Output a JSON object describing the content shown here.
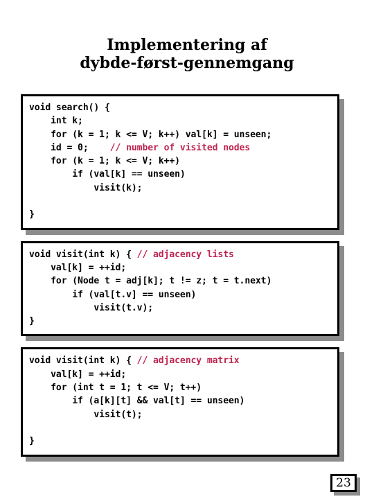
{
  "slide": {
    "title_lines": [
      "Implementering af",
      "dybde-først-gennemgang"
    ],
    "page_number": "23",
    "colors": {
      "text": "#000000",
      "comment": "#bf2350",
      "shadow": "#8c8c8c",
      "background": "#ffffff",
      "border": "#000000"
    }
  },
  "code_blocks": [
    {
      "name": "search-function",
      "lines": [
        [
          {
            "t": "void search() {",
            "k": "code"
          }
        ],
        [
          {
            "t": "    int k;",
            "k": "code"
          }
        ],
        [
          {
            "t": "    for (k = 1; k <= V; k++) val[k] = unseen;",
            "k": "code"
          }
        ],
        [
          {
            "t": "    id = 0;    ",
            "k": "code"
          },
          {
            "t": "// number of visited nodes",
            "k": "comment"
          }
        ],
        [
          {
            "t": "    for (k = 1; k <= V; k++)",
            "k": "code"
          }
        ],
        [
          {
            "t": "        if (val[k] == unseen)",
            "k": "code"
          }
        ],
        [
          {
            "t": "            visit(k);",
            "k": "code"
          }
        ],
        [
          {
            "t": "",
            "k": "code"
          }
        ],
        [
          {
            "t": "}",
            "k": "code"
          }
        ]
      ]
    },
    {
      "name": "visit-adjacency-lists",
      "lines": [
        [
          {
            "t": "void visit(int k) { ",
            "k": "code"
          },
          {
            "t": "// adjacency lists",
            "k": "comment"
          }
        ],
        [
          {
            "t": "    val[k] = ++id;",
            "k": "code"
          }
        ],
        [
          {
            "t": "    for (Node t = adj[k]; t != z; t = t.next)",
            "k": "code"
          }
        ],
        [
          {
            "t": "        if (val[t.v] == unseen)",
            "k": "code"
          }
        ],
        [
          {
            "t": "            visit(t.v);",
            "k": "code"
          }
        ],
        [
          {
            "t": "}",
            "k": "code"
          }
        ]
      ]
    },
    {
      "name": "visit-adjacency-matrix",
      "lines": [
        [
          {
            "t": "void visit(int k) { ",
            "k": "code"
          },
          {
            "t": "// adjacency matrix",
            "k": "comment"
          }
        ],
        [
          {
            "t": "    val[k] = ++id;",
            "k": "code"
          }
        ],
        [
          {
            "t": "    for (int t = 1; t <= V; t++)",
            "k": "code"
          }
        ],
        [
          {
            "t": "        if (a[k][t] && val[t] == unseen)",
            "k": "code"
          }
        ],
        [
          {
            "t": "            visit(t);",
            "k": "code"
          }
        ],
        [
          {
            "t": "",
            "k": "code"
          }
        ],
        [
          {
            "t": "}",
            "k": "code"
          }
        ]
      ]
    }
  ]
}
